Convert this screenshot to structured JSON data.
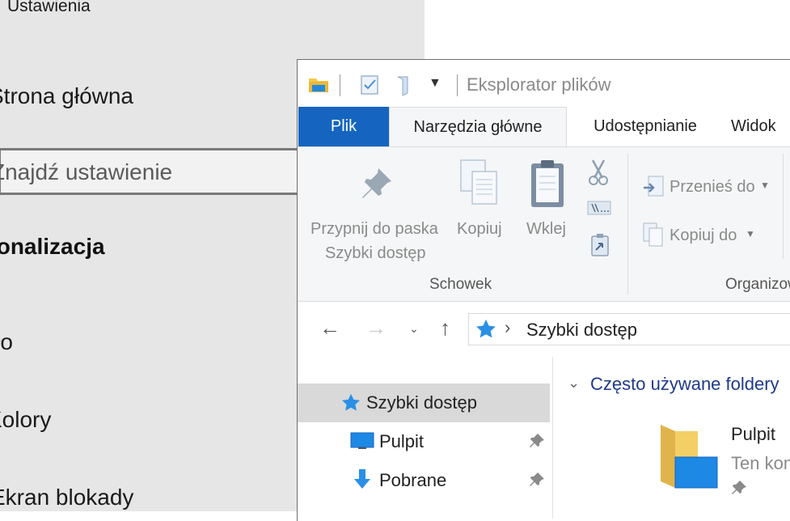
{
  "settings": {
    "title": "Ustawienia",
    "home_label": "Strona główna",
    "search_placeholder": "Znajdź ustawienie",
    "section_title": "Personalizacja",
    "nav": [
      {
        "label": "Tło"
      },
      {
        "label": "Kolory"
      },
      {
        "label": "Ekran blokady"
      }
    ]
  },
  "explorer": {
    "title": "Eksplorator plików",
    "tabs": [
      {
        "label": "Plik"
      },
      {
        "label": "Narzędzia główne"
      },
      {
        "label": "Udostępnianie"
      },
      {
        "label": "Widok"
      }
    ],
    "ribbon": {
      "pin_label_line1": "Przypnij do paska",
      "pin_label_line2": "Szybki dostęp",
      "copy_label": "Kopiuj",
      "paste_label": "Wklej",
      "clipboard_group": "Schowek",
      "move_to_label": "Przenieś do",
      "copy_to_label": "Kopiuj do",
      "organize_group": "Organizowanie"
    },
    "address": {
      "crumb": "Szybki dostęp"
    },
    "navpane": [
      {
        "label": "Szybki dostęp"
      },
      {
        "label": "Pulpit"
      },
      {
        "label": "Pobrane"
      }
    ],
    "content": {
      "group_title": "Często używane foldery",
      "folder_name": "Pulpit",
      "folder_location": "Ten komputer"
    }
  },
  "colors": {
    "accent": "#1565c0",
    "group_title": "#1e3a8a",
    "settings_bg": "#e6e6e6"
  }
}
